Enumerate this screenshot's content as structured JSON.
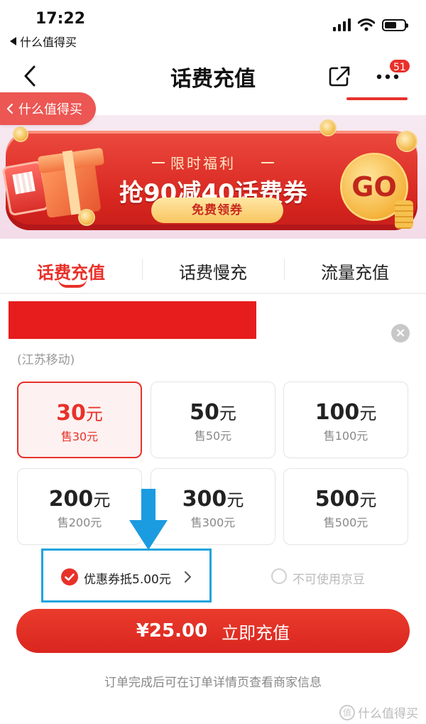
{
  "status_bar": {
    "time": "17:22",
    "back_app": "什么值得买"
  },
  "nav": {
    "title": "话费充值",
    "badge": "51"
  },
  "app_pill": {
    "label": "什么值得买"
  },
  "banner": {
    "subtitle": "限时福利",
    "headline": "抢90减40话费券",
    "cta": "免费领券",
    "go": "GO"
  },
  "tabs": [
    {
      "label": "话费充值",
      "active": true
    },
    {
      "label": "话费慢充",
      "active": false
    },
    {
      "label": "流量充值",
      "active": false
    }
  ],
  "phone": {
    "carrier": "(江苏移动)",
    "clear": "×"
  },
  "options": [
    {
      "amount": "30",
      "unit": "元",
      "price": "售30元",
      "selected": true
    },
    {
      "amount": "50",
      "unit": "元",
      "price": "售50元",
      "selected": false
    },
    {
      "amount": "100",
      "unit": "元",
      "price": "售100元",
      "selected": false
    },
    {
      "amount": "200",
      "unit": "元",
      "price": "售200元",
      "selected": false
    },
    {
      "amount": "300",
      "unit": "元",
      "price": "售300元",
      "selected": false
    },
    {
      "amount": "500",
      "unit": "元",
      "price": "售500元",
      "selected": false
    }
  ],
  "coupon": {
    "text": "优惠券抵5.00元",
    "checked": true
  },
  "beans": {
    "text": "不可使用京豆"
  },
  "submit": {
    "price": "¥25.00",
    "label": "立即充值"
  },
  "footer_note": "订单完成后可在订单详情页查看商家信息",
  "watermark": {
    "text": "什么值得买",
    "logo": "值"
  },
  "colors": {
    "accent": "#e8312a",
    "highlight_frame": "#1ea4dd"
  }
}
